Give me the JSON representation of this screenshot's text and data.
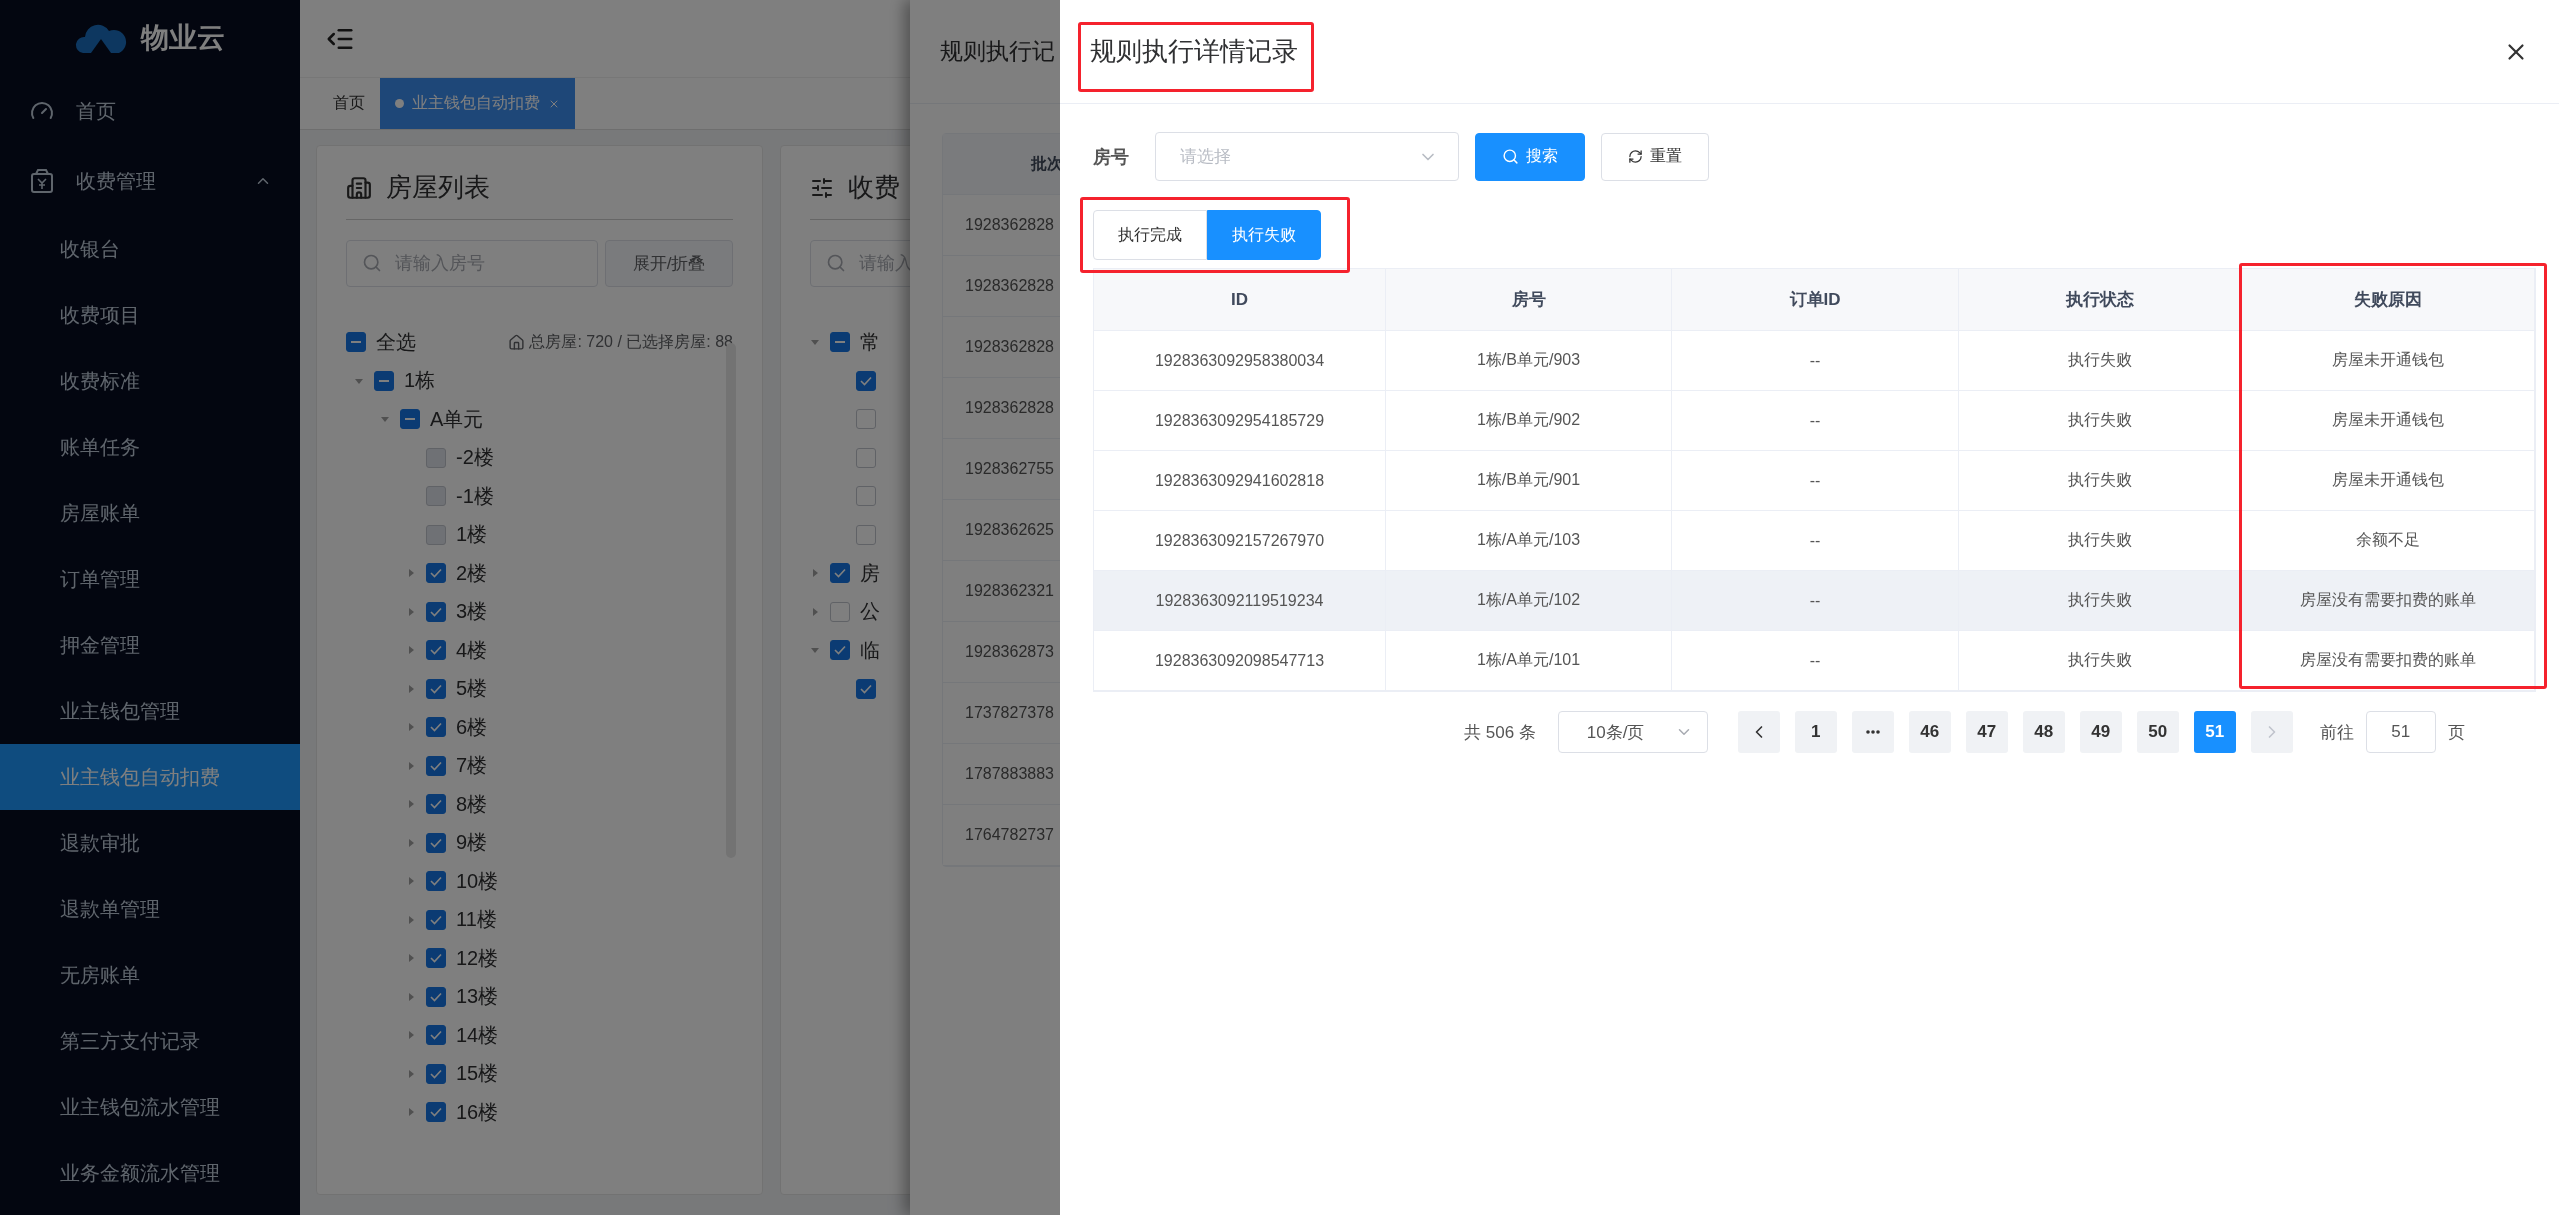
{
  "sidebar": {
    "logo": "物业云",
    "items": [
      {
        "label": "首页",
        "kind": "top",
        "selected": false
      },
      {
        "label": "收费管理",
        "kind": "group",
        "expanded": true,
        "selected": false,
        "children": [
          {
            "label": "收银台",
            "selected": false
          },
          {
            "label": "收费项目",
            "selected": false
          },
          {
            "label": "收费标准",
            "selected": false
          },
          {
            "label": "账单任务",
            "selected": false
          },
          {
            "label": "房屋账单",
            "selected": false
          },
          {
            "label": "订单管理",
            "selected": false
          },
          {
            "label": "押金管理",
            "selected": false
          },
          {
            "label": "业主钱包管理",
            "selected": false
          },
          {
            "label": "业主钱包自动扣费",
            "selected": true
          },
          {
            "label": "退款审批",
            "selected": false
          },
          {
            "label": "退款单管理",
            "selected": false
          },
          {
            "label": "无房账单",
            "selected": false
          },
          {
            "label": "第三方支付记录",
            "selected": false
          },
          {
            "label": "业主钱包流水管理",
            "selected": false
          },
          {
            "label": "业务金额流水管理",
            "selected": false
          }
        ]
      }
    ]
  },
  "tabs": [
    {
      "label": "首页",
      "selected": false,
      "closable": false
    },
    {
      "label": "业主钱包自动扣费",
      "selected": true,
      "closable": true
    }
  ],
  "house_panel": {
    "title": "房屋列表",
    "search": {
      "placeholder": "请输入房号"
    },
    "toggle_button": "展开/折叠",
    "select_all": {
      "label": "全选",
      "checked": false,
      "indeterminate": true
    },
    "stats": "总房屋: 720 / 已选择房屋: 88",
    "tree": [
      {
        "label": "1栋",
        "checked": false,
        "indeterminate": true,
        "expanded": true,
        "children": [
          {
            "label": "A单元",
            "checked": false,
            "indeterminate": true,
            "expanded": true,
            "children": [
              {
                "label": "-2楼",
                "checked": false,
                "disabled": true
              },
              {
                "label": "-1楼",
                "checked": false,
                "disabled": true
              },
              {
                "label": "1楼",
                "checked": false,
                "disabled": true
              },
              {
                "label": "2楼",
                "checked": true,
                "expanded": false
              },
              {
                "label": "3楼",
                "checked": true,
                "expanded": false
              },
              {
                "label": "4楼",
                "checked": true,
                "expanded": false
              },
              {
                "label": "5楼",
                "checked": true,
                "expanded": false
              },
              {
                "label": "6楼",
                "checked": true,
                "expanded": false
              },
              {
                "label": "7楼",
                "checked": true,
                "expanded": false
              },
              {
                "label": "8楼",
                "checked": true,
                "expanded": false
              },
              {
                "label": "9楼",
                "checked": true,
                "expanded": false
              },
              {
                "label": "10楼",
                "checked": true,
                "expanded": false
              },
              {
                "label": "11楼",
                "checked": true,
                "expanded": false
              },
              {
                "label": "12楼",
                "checked": true,
                "expanded": false
              },
              {
                "label": "13楼",
                "checked": true,
                "expanded": false
              },
              {
                "label": "14楼",
                "checked": true,
                "expanded": false
              },
              {
                "label": "15楼",
                "checked": true,
                "expanded": false
              },
              {
                "label": "16楼",
                "checked": true,
                "expanded": false
              }
            ]
          }
        ]
      }
    ]
  },
  "fee_panel": {
    "title": "收费",
    "search": {
      "placeholder": "请输入"
    },
    "tree": [
      {
        "label": "常",
        "checked": false,
        "indeterminate": true,
        "expanded": true,
        "children": [
          {
            "checked": true
          },
          {
            "checked": false
          },
          {
            "checked": false
          },
          {
            "checked": false
          },
          {
            "checked": false
          }
        ]
      },
      {
        "label": "房",
        "checked": true,
        "expanded": false
      },
      {
        "label": "公",
        "checked": false,
        "expanded": false
      },
      {
        "label": "临",
        "checked": true,
        "expanded": true,
        "children": [
          {
            "checked": true
          }
        ]
      }
    ]
  },
  "records_drawer": {
    "title": "规则执行记",
    "column_1": "批次",
    "rows": [
      "1928362828",
      "1928362828",
      "1928362828",
      "1928362828",
      "1928362755",
      "1928362625",
      "1928362321",
      "1928362873",
      "1737827378",
      "1787883883",
      "1764782737"
    ]
  },
  "detail_drawer": {
    "title": "规则执行详情记录",
    "filter": {
      "label": "房号",
      "placeholder": "请选择",
      "search_button": "搜索",
      "reset_button": "重置"
    },
    "status_tabs": [
      {
        "label": "执行完成",
        "selected": false
      },
      {
        "label": "执行失败",
        "selected": true
      }
    ],
    "table": {
      "columns": [
        "ID",
        "房号",
        "订单ID",
        "执行状态",
        "失败原因"
      ],
      "rows": [
        {
          "cells": [
            "1928363092958380034",
            "1栋/B单元/903",
            "--",
            "执行失败",
            "房屋未开通钱包"
          ],
          "hovered": false
        },
        {
          "cells": [
            "1928363092954185729",
            "1栋/B单元/902",
            "--",
            "执行失败",
            "房屋未开通钱包"
          ],
          "hovered": false
        },
        {
          "cells": [
            "1928363092941602818",
            "1栋/B单元/901",
            "--",
            "执行失败",
            "房屋未开通钱包"
          ],
          "hovered": false
        },
        {
          "cells": [
            "1928363092157267970",
            "1栋/A单元/103",
            "--",
            "执行失败",
            "余额不足"
          ],
          "hovered": false
        },
        {
          "cells": [
            "1928363092119519234",
            "1栋/A单元/102",
            "--",
            "执行失败",
            "房屋没有需要扣费的账单"
          ],
          "hovered": true
        },
        {
          "cells": [
            "1928363092098547713",
            "1栋/A单元/101",
            "--",
            "执行失败",
            "房屋没有需要扣费的账单"
          ],
          "hovered": false
        }
      ]
    },
    "pagination": {
      "total": "共 506 条",
      "page_size": "10条/页",
      "prev_disabled": false,
      "next_disabled": true,
      "pages": [
        {
          "kind": "page",
          "label": "1",
          "selected": false
        },
        {
          "kind": "more",
          "selected": false
        },
        {
          "kind": "page",
          "label": "46",
          "selected": false
        },
        {
          "kind": "page",
          "label": "47",
          "selected": false
        },
        {
          "kind": "page",
          "label": "48",
          "selected": false
        },
        {
          "kind": "page",
          "label": "49",
          "selected": false
        },
        {
          "kind": "page",
          "label": "50",
          "selected": false
        },
        {
          "kind": "page",
          "label": "51",
          "selected": true
        }
      ],
      "jumper_label": "前往",
      "jumper_value": "51",
      "jumper_suffix": "页"
    }
  },
  "annotations": [
    {
      "kind": "title"
    },
    {
      "kind": "tabs"
    },
    {
      "kind": "column"
    }
  ]
}
